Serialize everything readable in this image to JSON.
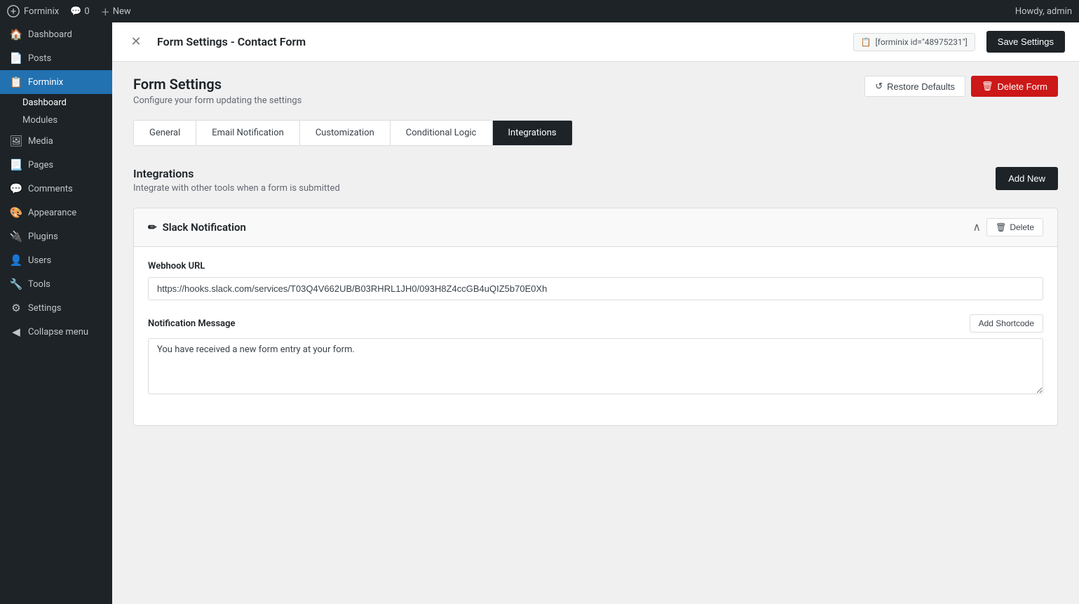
{
  "adminBar": {
    "siteName": "Forminix",
    "comments": "0",
    "newLabel": "New",
    "howdy": "Howdy, admin"
  },
  "sidebar": {
    "items": [
      {
        "id": "dashboard",
        "label": "Dashboard",
        "icon": "🏠"
      },
      {
        "id": "posts",
        "label": "Posts",
        "icon": "📄"
      },
      {
        "id": "forminix",
        "label": "Forminix",
        "icon": "📋",
        "active": true
      },
      {
        "id": "dashboard-sub",
        "label": "Dashboard",
        "sub": true
      },
      {
        "id": "modules-sub",
        "label": "Modules",
        "sub": true
      },
      {
        "id": "media",
        "label": "Media",
        "icon": "🖼"
      },
      {
        "id": "pages",
        "label": "Pages",
        "icon": "📃"
      },
      {
        "id": "comments",
        "label": "Comments",
        "icon": "💬"
      },
      {
        "id": "appearance",
        "label": "Appearance",
        "icon": "🎨"
      },
      {
        "id": "plugins",
        "label": "Plugins",
        "icon": "🔌"
      },
      {
        "id": "users",
        "label": "Users",
        "icon": "👤"
      },
      {
        "id": "tools",
        "label": "Tools",
        "icon": "🔧"
      },
      {
        "id": "settings",
        "label": "Settings",
        "icon": "⚙"
      },
      {
        "id": "collapse",
        "label": "Collapse menu",
        "icon": "◀"
      }
    ]
  },
  "formEditorHeader": {
    "title": "Form Settings - Contact Form",
    "shortcode": "[forminix id=\"48975231\"]",
    "saveLabel": "Save Settings"
  },
  "pageHeader": {
    "title": "Form Settings",
    "subtitle": "Configure your form updating the settings",
    "restoreLabel": "Restore Defaults",
    "deleteLabel": "Delete Form"
  },
  "tabs": [
    {
      "id": "general",
      "label": "General"
    },
    {
      "id": "email-notification",
      "label": "Email Notification"
    },
    {
      "id": "customization",
      "label": "Customization"
    },
    {
      "id": "conditional-logic",
      "label": "Conditional Logic"
    },
    {
      "id": "integrations",
      "label": "Integrations",
      "active": true
    }
  ],
  "integrations": {
    "title": "Integrations",
    "subtitle": "Integrate with other tools when a form is submitted",
    "addNewLabel": "Add New",
    "card": {
      "title": "Slack Notification",
      "editIcon": "✏",
      "deleteLabel": "Delete",
      "webhookLabel": "Webhook URL",
      "webhookValue": "https://hooks.slack.com/services/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",
      "notificationLabel": "Notification Message",
      "addShortcodeLabel": "Add Shortcode",
      "notificationValue": "You have received a new form entry at your form."
    }
  }
}
